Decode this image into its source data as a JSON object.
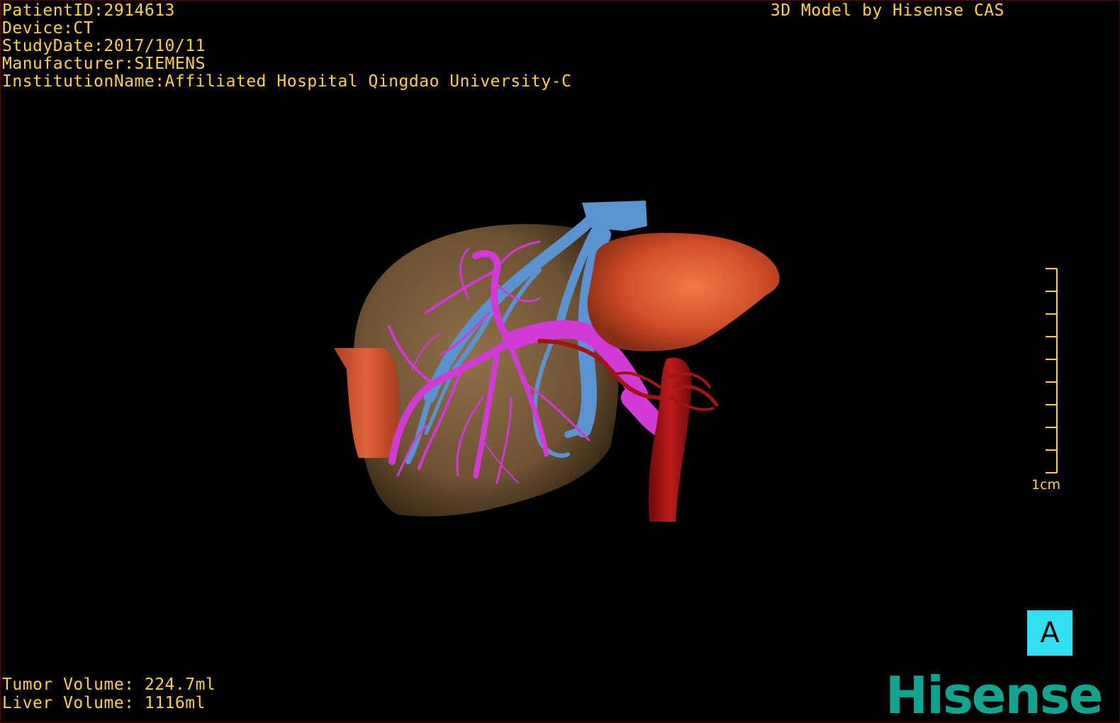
{
  "header": {
    "patient_id": "PatientID:2914613",
    "device": "Device:CT",
    "study_date": "StudyDate:2017/10/11",
    "manufacturer": "Manufacturer:SIEMENS",
    "institution": "InstitutionName:Affiliated Hospital Qingdao University-C",
    "model_credit": "3D Model by Hisense CAS"
  },
  "volumes": {
    "tumor": "Tumor Volume: 224.7ml",
    "liver": "Liver Volume: 1116ml"
  },
  "scale_bar": {
    "label": "1cm",
    "ticks": 10
  },
  "orientation": {
    "label": "A"
  },
  "logo": {
    "text": "Hisense"
  },
  "colors": {
    "overlay_text": "#ffd23a",
    "liver": "#8a6a44",
    "organ_red_orange": "#d9502a",
    "portal_vein": "#d23ad8",
    "hepatic_vein": "#5a93d1",
    "artery": "#a01414",
    "orientation_box": "#2ee0f0",
    "logo": "#10a58f"
  }
}
